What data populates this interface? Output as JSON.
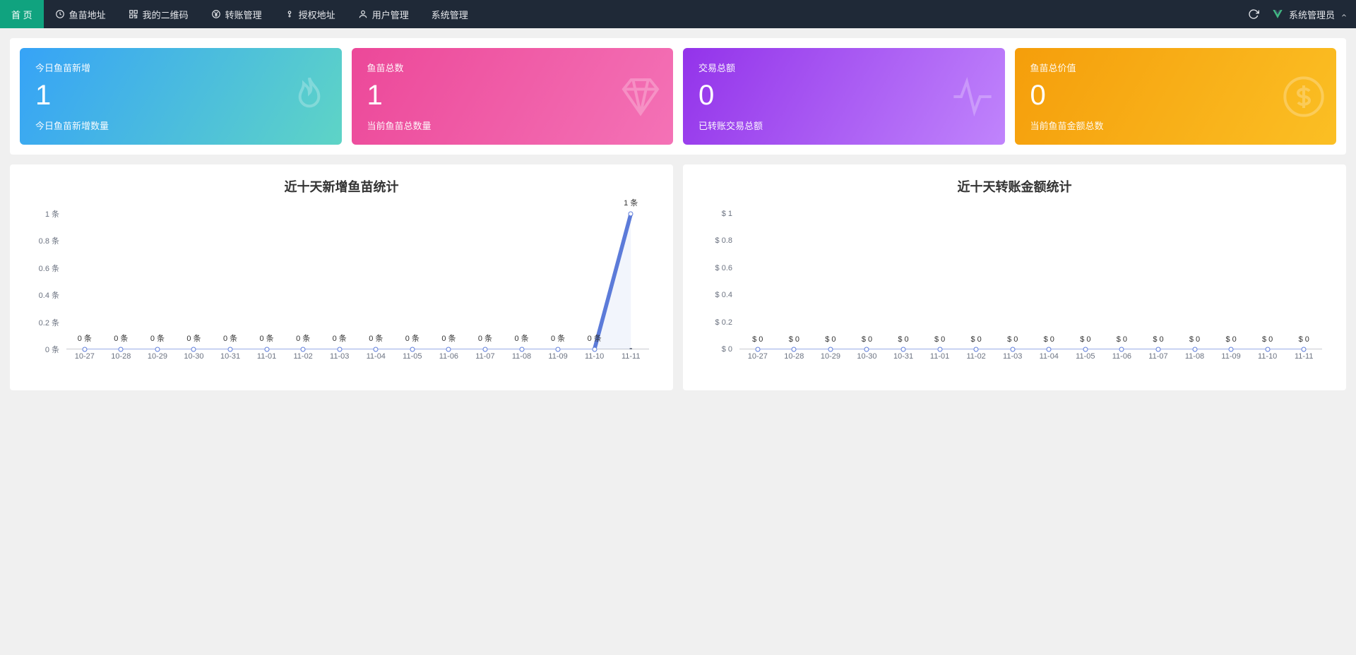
{
  "nav": {
    "items": [
      {
        "label": "首 页",
        "icon": "",
        "active": true
      },
      {
        "label": "鱼苗地址",
        "icon": "clock",
        "active": false
      },
      {
        "label": "我的二维码",
        "icon": "qrcode",
        "active": false
      },
      {
        "label": "转账管理",
        "icon": "yen",
        "active": false
      },
      {
        "label": "授权地址",
        "icon": "key",
        "active": false
      },
      {
        "label": "用户管理",
        "icon": "user",
        "active": false
      },
      {
        "label": "系统管理",
        "icon": "",
        "active": false
      }
    ],
    "user_label": "系统管理员"
  },
  "stats": [
    {
      "title": "今日鱼苗新增",
      "value": "1",
      "desc": "今日鱼苗新增数量",
      "grad": "grad-blue",
      "icon": "flame"
    },
    {
      "title": "鱼苗总数",
      "value": "1",
      "desc": "当前鱼苗总数量",
      "grad": "grad-pink",
      "icon": "diamond"
    },
    {
      "title": "交易总额",
      "value": "0",
      "desc": "已转账交易总额",
      "grad": "grad-purple",
      "icon": "pulse"
    },
    {
      "title": "鱼苗总价值",
      "value": "0",
      "desc": "当前鱼苗金额总数",
      "grad": "grad-orange",
      "icon": "dollar"
    }
  ],
  "chart_data": [
    {
      "type": "line",
      "title": "近十天新增鱼苗统计",
      "categories": [
        "10-27",
        "10-28",
        "10-29",
        "10-30",
        "10-31",
        "11-01",
        "11-02",
        "11-03",
        "11-04",
        "11-05",
        "11-06",
        "11-07",
        "11-08",
        "11-09",
        "11-10",
        "11-11"
      ],
      "values": [
        0,
        0,
        0,
        0,
        0,
        0,
        0,
        0,
        0,
        0,
        0,
        0,
        0,
        0,
        0,
        1
      ],
      "value_labels": [
        "0 条",
        "0 条",
        "0 条",
        "0 条",
        "0 条",
        "0 条",
        "0 条",
        "0 条",
        "0 条",
        "0 条",
        "0 条",
        "0 条",
        "0 条",
        "0 条",
        "0 条",
        "1 条"
      ],
      "yticks": [
        0,
        0.2,
        0.4,
        0.6,
        0.8,
        1
      ],
      "ytick_labels": [
        "0 条",
        "0.2 条",
        "0.4 条",
        "0.6 条",
        "0.8 条",
        "1 条"
      ],
      "ylim": [
        0,
        1
      ]
    },
    {
      "type": "line",
      "title": "近十天转账金额统计",
      "categories": [
        "10-27",
        "10-28",
        "10-29",
        "10-30",
        "10-31",
        "11-01",
        "11-02",
        "11-03",
        "11-04",
        "11-05",
        "11-06",
        "11-07",
        "11-08",
        "11-09",
        "11-10",
        "11-11"
      ],
      "values": [
        0,
        0,
        0,
        0,
        0,
        0,
        0,
        0,
        0,
        0,
        0,
        0,
        0,
        0,
        0,
        0
      ],
      "value_labels": [
        "$ 0",
        "$ 0",
        "$ 0",
        "$ 0",
        "$ 0",
        "$ 0",
        "$ 0",
        "$ 0",
        "$ 0",
        "$ 0",
        "$ 0",
        "$ 0",
        "$ 0",
        "$ 0",
        "$ 0",
        "$ 0"
      ],
      "yticks": [
        0,
        0.2,
        0.4,
        0.6,
        0.8,
        1
      ],
      "ytick_labels": [
        "$ 0",
        "$ 0.2",
        "$ 0.4",
        "$ 0.6",
        "$ 0.8",
        "$ 1"
      ],
      "ylim": [
        0,
        1
      ]
    }
  ]
}
